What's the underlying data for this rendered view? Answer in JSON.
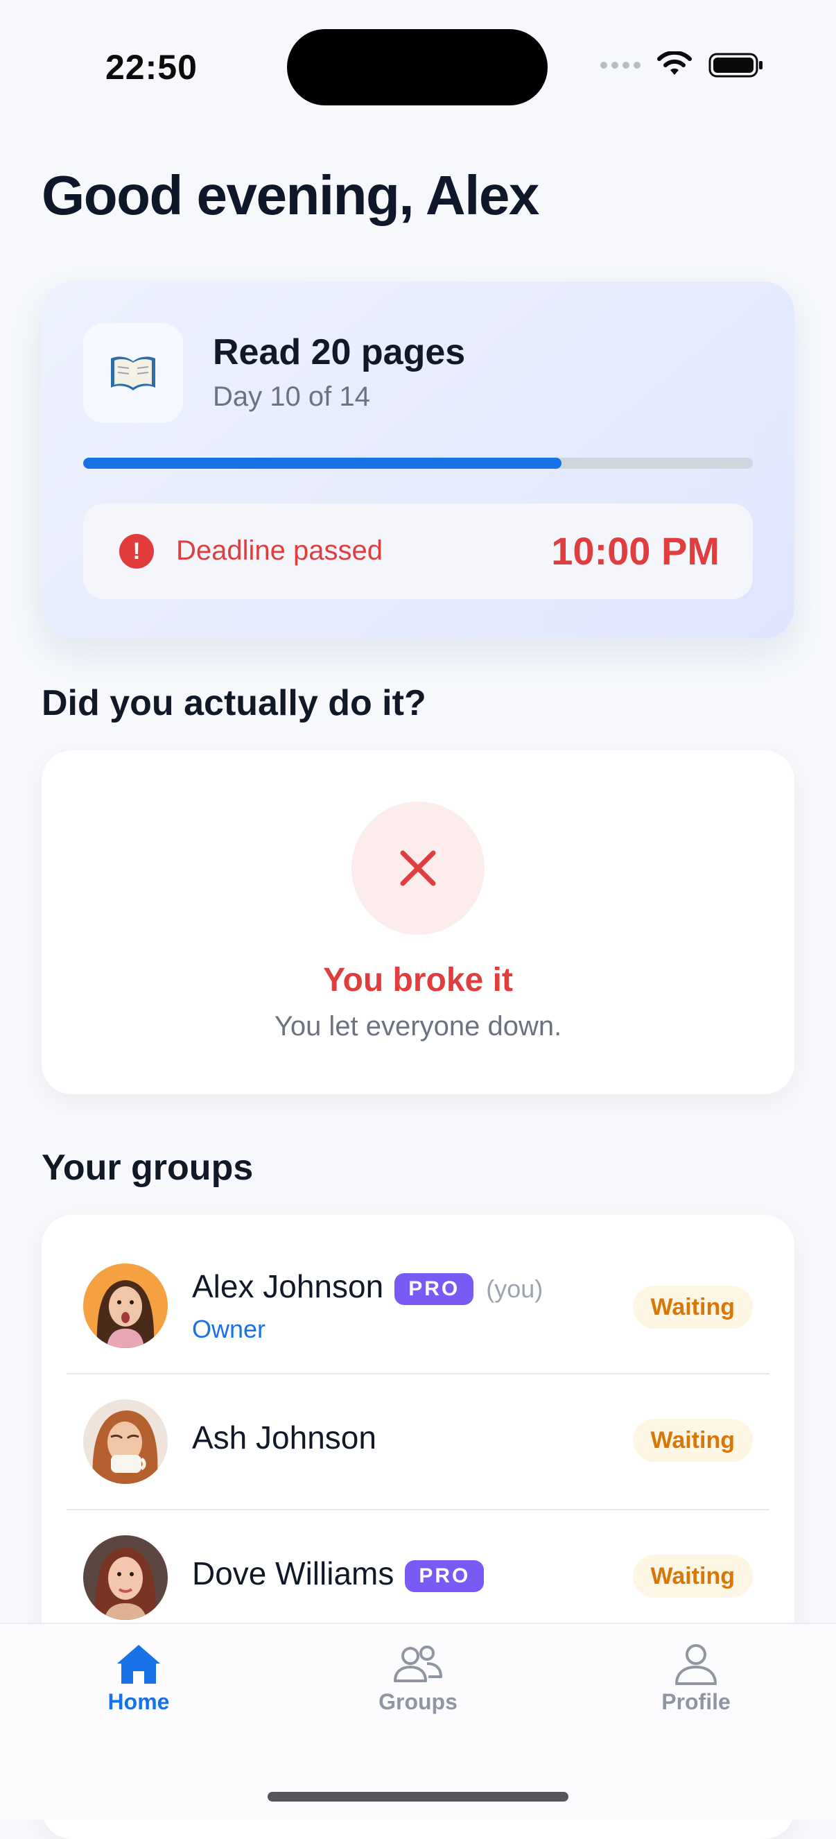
{
  "status_bar": {
    "time": "22:50"
  },
  "greeting": "Good evening, Alex",
  "challenge": {
    "icon": "open-book",
    "title": "Read 20 pages",
    "subtitle": "Day 10 of 14",
    "progress_fraction": 0.714,
    "deadline_label": "Deadline passed",
    "deadline_time": "10:00 PM"
  },
  "check_in": {
    "heading": "Did you actually do it?",
    "result_title": "You broke it",
    "result_subtitle": "You let everyone down."
  },
  "groups": {
    "heading": "Your groups",
    "members": [
      {
        "name": "Alex Johnson",
        "badge": "PRO",
        "you_label": "(you)",
        "role": "Owner",
        "status": "Waiting"
      },
      {
        "name": "Ash Johnson",
        "status": "Waiting"
      },
      {
        "name": "Dove Williams",
        "badge": "PRO",
        "status": "Waiting"
      }
    ]
  },
  "tab_bar": {
    "tabs": [
      {
        "label": "Home",
        "icon": "home-icon",
        "active": true
      },
      {
        "label": "Groups",
        "icon": "groups-icon",
        "active": false
      },
      {
        "label": "Profile",
        "icon": "profile-icon",
        "active": false
      }
    ]
  },
  "colors": {
    "accent": "#1772e8",
    "danger": "#e03e3e",
    "pro": "#7a5af5",
    "waiting": "#d97706"
  }
}
